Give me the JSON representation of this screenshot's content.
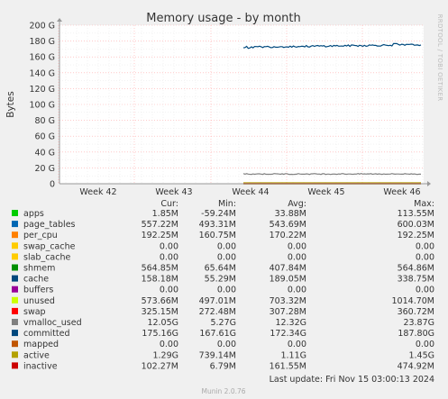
{
  "chart_data": {
    "type": "line",
    "title": "Memory usage - by month",
    "ylabel": "Bytes",
    "ylim": [
      0,
      200
    ],
    "y_unit": "G",
    "y_ticks": [
      "0",
      "20 G",
      "40 G",
      "60 G",
      "80 G",
      "100 G",
      "120 G",
      "140 G",
      "160 G",
      "180 G",
      "200 G"
    ],
    "x_ticks": [
      "Week 42",
      "Week 43",
      "Week 44",
      "Week 45",
      "Week 46"
    ],
    "grid": true,
    "side_label": "RRDTOOL / TOBI OETIKER",
    "legend_headers": [
      "Cur:",
      "Min:",
      "Avg:",
      "Max:"
    ],
    "series": [
      {
        "name": "apps",
        "color": "#00cc00",
        "cur": "1.85M",
        "min": "-59.24M",
        "avg": "33.88M",
        "max": "113.55M"
      },
      {
        "name": "page_tables",
        "color": "#0066b3",
        "cur": "557.22M",
        "min": "493.31M",
        "avg": "543.69M",
        "max": "600.03M"
      },
      {
        "name": "per_cpu",
        "color": "#ff8000",
        "cur": "192.25M",
        "min": "160.75M",
        "avg": "170.22M",
        "max": "192.25M"
      },
      {
        "name": "swap_cache",
        "color": "#ffcc00",
        "cur": "0.00",
        "min": "0.00",
        "avg": "0.00",
        "max": "0.00"
      },
      {
        "name": "slab_cache",
        "color": "#ffcc00",
        "cur": "0.00",
        "min": "0.00",
        "avg": "0.00",
        "max": "0.00"
      },
      {
        "name": "shmem",
        "color": "#008f00",
        "cur": "564.85M",
        "min": "65.64M",
        "avg": "407.84M",
        "max": "564.86M"
      },
      {
        "name": "cache",
        "color": "#00487d",
        "cur": "158.18M",
        "min": "55.29M",
        "avg": "189.05M",
        "max": "338.75M"
      },
      {
        "name": "buffers",
        "color": "#990099",
        "cur": "0.00",
        "min": "0.00",
        "avg": "0.00",
        "max": "0.00"
      },
      {
        "name": "unused",
        "color": "#ccff00",
        "cur": "573.66M",
        "min": "497.01M",
        "avg": "703.32M",
        "max": "1014.70M"
      },
      {
        "name": "swap",
        "color": "#ff0000",
        "cur": "325.15M",
        "min": "272.48M",
        "avg": "307.28M",
        "max": "360.72M"
      },
      {
        "name": "vmalloc_used",
        "color": "#808080",
        "cur": "12.05G",
        "min": "5.27G",
        "avg": "12.32G",
        "max": "23.87G"
      },
      {
        "name": "committed",
        "color": "#00487d",
        "cur": "175.16G",
        "min": "167.61G",
        "avg": "172.34G",
        "max": "187.80G"
      },
      {
        "name": "mapped",
        "color": "#c05500",
        "cur": "0.00",
        "min": "0.00",
        "avg": "0.00",
        "max": "0.00"
      },
      {
        "name": "active",
        "color": "#b3a100",
        "cur": "1.29G",
        "min": "739.14M",
        "avg": "1.11G",
        "max": "1.45G"
      },
      {
        "name": "inactive",
        "color": "#cc0000",
        "cur": "102.27M",
        "min": "6.79M",
        "avg": "161.55M",
        "max": "474.92M"
      }
    ],
    "last_update": "Last update: Fri Nov 15 03:00:13 2024",
    "footer": "Munin 2.0.76"
  }
}
